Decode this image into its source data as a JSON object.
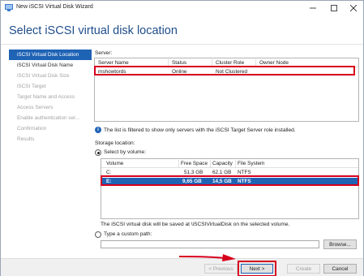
{
  "window": {
    "title": "New iSCSI Virtual Disk Wizard",
    "heading": "Select iSCSI virtual disk location"
  },
  "nav": [
    {
      "label": "iSCSI Virtual Disk Location",
      "state": "active"
    },
    {
      "label": "iSCSI Virtual Disk Name",
      "state": "normal"
    },
    {
      "label": "iSCSI Virtual Disk Size",
      "state": "disabled"
    },
    {
      "label": "iSCSI Target",
      "state": "disabled"
    },
    {
      "label": "Target Name and Access",
      "state": "disabled"
    },
    {
      "label": "Access Servers",
      "state": "disabled"
    },
    {
      "label": "Enable authentication ser...",
      "state": "disabled"
    },
    {
      "label": "Confirmation",
      "state": "disabled"
    },
    {
      "label": "Results",
      "state": "disabled"
    }
  ],
  "server": {
    "label": "Server:",
    "columns": [
      "Server Name",
      "Status",
      "Cluster Role",
      "Owner Node"
    ],
    "rows": [
      {
        "name": "mshowtords",
        "status": "Online",
        "cluster_role": "Not Clustered",
        "owner_node": ""
      }
    ],
    "info": "The list is filtered to show only servers with the iSCSI Target Server role installed."
  },
  "storage": {
    "label": "Storage location:",
    "select_by_volume": "Select by volume:",
    "columns": [
      "Volume",
      "Free Space",
      "Capacity",
      "File System"
    ],
    "volumes": [
      {
        "volume": "C:",
        "free": "51,3 GB",
        "capacity": "62,1 GB",
        "fs": "NTFS",
        "selected": false
      },
      {
        "volume": "E:",
        "free": "9,65 GB",
        "capacity": "14,5 GB",
        "fs": "NTFS",
        "selected": true
      }
    ],
    "save_note": "The iSCSI virtual disk will be saved at \\iSCSIVirtualDisk on the selected volume.",
    "custom_path": "Type a custom path:",
    "custom_path_value": "",
    "browse": "Browse..."
  },
  "buttons": {
    "previous": "< Previous",
    "next": "Next >",
    "create": "Create",
    "cancel": "Cancel"
  },
  "colors": {
    "accent": "#1f63b5",
    "highlight": "#d6001c",
    "heading": "#1f4e8c"
  }
}
